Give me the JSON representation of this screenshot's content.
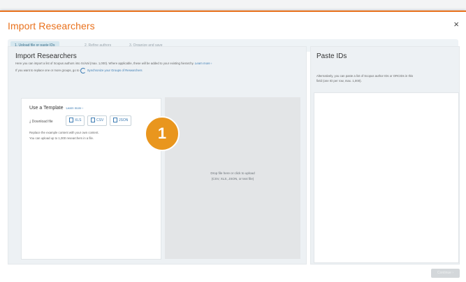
{
  "dialog": {
    "title": "Import Researchers",
    "close_glyph": "×"
  },
  "steps": [
    {
      "label": "1. Upload file or paste IDs",
      "active": true
    },
    {
      "label": "2. Refine authors",
      "active": false
    },
    {
      "label": "3. Organize and save",
      "active": false
    }
  ],
  "import_panel": {
    "title": "Import Researchers",
    "description": "Here you can import a list of Scopus authors into SciVal (max. 1,000). Where applicable, these will be added to your existing hierarchy.",
    "learn_more": "Learn more ›",
    "replace_text": "If you want to replace one or more groups, go to",
    "sync_link": "Synchronize your Groups of Researchers",
    "sync_icon": "sync-icon"
  },
  "template": {
    "title": "Use a Template",
    "learn_more": "Learn more ›",
    "download_label": "Download file",
    "download_icon": "download-icon",
    "buttons": [
      "XLS",
      "CSV",
      "JSON"
    ],
    "instructions_1": "Replace the example content with your own content.",
    "instructions_2": "You can upload up to 1,000 researchers in a file."
  },
  "dropzone": {
    "line1": "Drop file here or click to upload",
    "line2": "(CSV, XLS, JSON, or text file)"
  },
  "paste_panel": {
    "title": "Paste IDs",
    "description_1": "Alternatively, you can paste a list of Scopus author IDs or ORCIDs in this",
    "description_2": "field (one ID per row, max. 1,000)."
  },
  "callout": {
    "number": "1",
    "color": "#e9961e"
  },
  "footer": {
    "continue_label": "Continue ›"
  },
  "colors": {
    "accent": "#e9711c",
    "link": "#3b7bb3"
  }
}
